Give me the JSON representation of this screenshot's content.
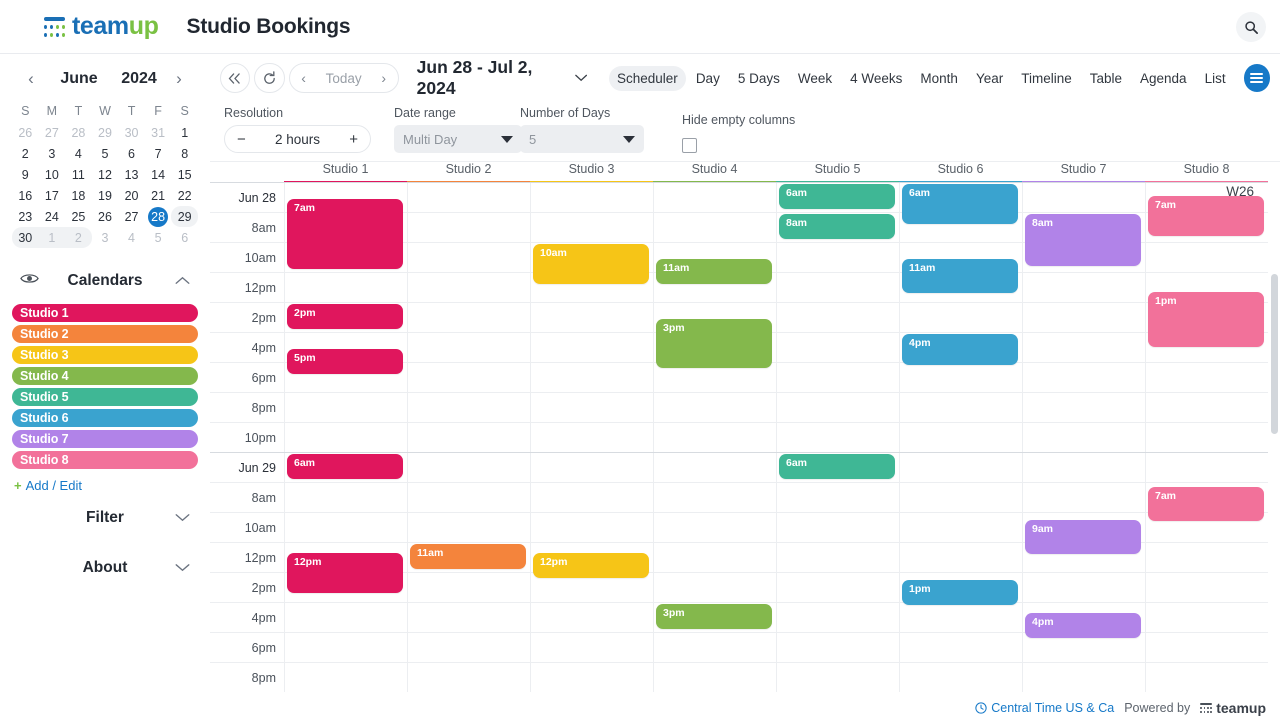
{
  "header": {
    "logo_text_1": "team",
    "logo_text_2": "up",
    "title": "Studio Bookings",
    "search_icon": "search-icon"
  },
  "sidebar": {
    "mini_calendar": {
      "prev_label": "‹",
      "next_label": "›",
      "month": "June",
      "year": "2024",
      "weekday_headers": [
        "S",
        "M",
        "T",
        "W",
        "T",
        "F",
        "S"
      ],
      "weeks": [
        [
          {
            "d": "26",
            "muted": true
          },
          {
            "d": "27",
            "muted": true
          },
          {
            "d": "28",
            "muted": true
          },
          {
            "d": "29",
            "muted": true
          },
          {
            "d": "30",
            "muted": true
          },
          {
            "d": "31",
            "muted": true
          },
          {
            "d": "1",
            "muted": false
          }
        ],
        [
          {
            "d": "2"
          },
          {
            "d": "3"
          },
          {
            "d": "4"
          },
          {
            "d": "5"
          },
          {
            "d": "6"
          },
          {
            "d": "7"
          },
          {
            "d": "8"
          }
        ],
        [
          {
            "d": "9"
          },
          {
            "d": "10"
          },
          {
            "d": "11"
          },
          {
            "d": "12"
          },
          {
            "d": "13"
          },
          {
            "d": "14"
          },
          {
            "d": "15"
          }
        ],
        [
          {
            "d": "16"
          },
          {
            "d": "17"
          },
          {
            "d": "18"
          },
          {
            "d": "19"
          },
          {
            "d": "20"
          },
          {
            "d": "21"
          },
          {
            "d": "22"
          }
        ],
        [
          {
            "d": "23"
          },
          {
            "d": "24"
          },
          {
            "d": "25"
          },
          {
            "d": "26"
          },
          {
            "d": "27"
          },
          {
            "d": "28",
            "selected": true
          },
          {
            "d": "29",
            "inrange": true
          }
        ],
        [
          {
            "d": "30",
            "inrange": true
          },
          {
            "d": "1",
            "muted": true,
            "inrange": true
          },
          {
            "d": "2",
            "muted": true,
            "inrange": true
          },
          {
            "d": "3",
            "muted": true
          },
          {
            "d": "4",
            "muted": true
          },
          {
            "d": "5",
            "muted": true
          },
          {
            "d": "6",
            "muted": true
          }
        ]
      ]
    },
    "calendars_section": {
      "title": "Calendars",
      "eye_icon": "eye-icon",
      "collapse_icon": "chevron-up-icon",
      "items": [
        {
          "label": "Studio 1",
          "color": "#e0165d"
        },
        {
          "label": "Studio 2",
          "color": "#f4843c"
        },
        {
          "label": "Studio 3",
          "color": "#f6c517"
        },
        {
          "label": "Studio 4",
          "color": "#84b84c"
        },
        {
          "label": "Studio 5",
          "color": "#3fb795"
        },
        {
          "label": "Studio 6",
          "color": "#3aa3cf"
        },
        {
          "label": "Studio 7",
          "color": "#b183e8"
        },
        {
          "label": "Studio 8",
          "color": "#f2719a"
        }
      ],
      "add_edit_label": "Add / Edit",
      "add_edit_plus": "+"
    },
    "filter_section": {
      "title": "Filter",
      "chevron": "chevron-down-icon"
    },
    "about_section": {
      "title": "About",
      "chevron": "chevron-down-icon"
    }
  },
  "toolbar": {
    "collapse_icon": "double-chevron-left-icon",
    "refresh_icon": "refresh-icon",
    "prev_label": "‹",
    "today_label": "Today",
    "next_label": "›",
    "date_range": "Jun 28 - Jul 2, 2024",
    "date_range_caret": "⌄",
    "views": [
      {
        "label": "Scheduler",
        "active": true
      },
      {
        "label": "Day",
        "active": false
      },
      {
        "label": "5 Days",
        "active": false
      },
      {
        "label": "Week",
        "active": false
      },
      {
        "label": "4 Weeks",
        "active": false
      },
      {
        "label": "Month",
        "active": false
      },
      {
        "label": "Year",
        "active": false
      },
      {
        "label": "Timeline",
        "active": false
      },
      {
        "label": "Table",
        "active": false
      },
      {
        "label": "Agenda",
        "active": false
      },
      {
        "label": "List",
        "active": false
      }
    ],
    "menu_icon": "hamburger-menu-icon"
  },
  "options": {
    "resolution_label": "Resolution",
    "resolution_minus": "−",
    "resolution_value": "2 hours",
    "resolution_plus": "+",
    "date_range_label": "Date range",
    "date_range_value": "Multi Day",
    "number_of_days_label": "Number of Days",
    "number_of_days_value": "5",
    "hide_empty_label": "Hide empty columns",
    "hide_empty_checked": false
  },
  "scheduler": {
    "week_badge": "W26",
    "columns": [
      {
        "label": "Studio 1",
        "color": "#e0165d"
      },
      {
        "label": "Studio 2",
        "color": "#f4843c"
      },
      {
        "label": "Studio 3",
        "color": "#f6c517"
      },
      {
        "label": "Studio 4",
        "color": "#84b84c"
      },
      {
        "label": "Studio 5",
        "color": "#3fb795"
      },
      {
        "label": "Studio 6",
        "color": "#3aa3cf"
      },
      {
        "label": "Studio 7",
        "color": "#b183e8"
      },
      {
        "label": "Studio 8",
        "color": "#f2719a"
      }
    ],
    "rows": [
      {
        "label": "Jun 28",
        "day_start": true
      },
      {
        "label": "8am"
      },
      {
        "label": "10am"
      },
      {
        "label": "12pm"
      },
      {
        "label": "2pm"
      },
      {
        "label": "4pm"
      },
      {
        "label": "6pm"
      },
      {
        "label": "8pm"
      },
      {
        "label": "10pm"
      },
      {
        "label": "Jun 29",
        "day_start": true
      },
      {
        "label": "8am"
      },
      {
        "label": "10am"
      },
      {
        "label": "12pm"
      },
      {
        "label": "2pm"
      },
      {
        "label": "4pm"
      },
      {
        "label": "6pm"
      },
      {
        "label": "8pm"
      }
    ],
    "events": [
      {
        "time": "7am",
        "col": 0,
        "row": 0,
        "rows": 2.5,
        "offset": 0.5,
        "color": "#e0165d"
      },
      {
        "time": "2pm",
        "col": 0,
        "row": 4,
        "rows": 1,
        "offset": 0.0,
        "color": "#e0165d"
      },
      {
        "time": "5pm",
        "col": 0,
        "row": 5,
        "rows": 1,
        "offset": 0.5,
        "color": "#e0165d"
      },
      {
        "time": "10am",
        "col": 2,
        "row": 2,
        "rows": 1.5,
        "offset": 0.0,
        "color": "#f6c517"
      },
      {
        "time": "11am",
        "col": 3,
        "row": 2,
        "rows": 1,
        "offset": 0.5,
        "color": "#84b84c"
      },
      {
        "time": "3pm",
        "col": 3,
        "row": 4,
        "rows": 1.8,
        "offset": 0.5,
        "color": "#84b84c"
      },
      {
        "time": "6am",
        "col": 4,
        "row": 0,
        "rows": 1,
        "offset": 0.0,
        "color": "#3fb795"
      },
      {
        "time": "8am",
        "col": 4,
        "row": 1,
        "rows": 1,
        "offset": 0.0,
        "color": "#3fb795"
      },
      {
        "time": "6am",
        "col": 5,
        "row": 0,
        "rows": 1.5,
        "offset": 0.0,
        "color": "#3aa3cf"
      },
      {
        "time": "11am",
        "col": 5,
        "row": 2,
        "rows": 1.3,
        "offset": 0.5,
        "color": "#3aa3cf"
      },
      {
        "time": "4pm",
        "col": 5,
        "row": 5,
        "rows": 1.2,
        "offset": 0.0,
        "color": "#3aa3cf"
      },
      {
        "time": "8am",
        "col": 6,
        "row": 1,
        "rows": 1.9,
        "offset": 0.0,
        "color": "#b183e8"
      },
      {
        "time": "7am",
        "col": 7,
        "row": 0,
        "rows": 1.5,
        "offset": 0.4,
        "color": "#f2719a"
      },
      {
        "time": "1pm",
        "col": 7,
        "row": 3,
        "rows": 2.0,
        "offset": 0.6,
        "color": "#f2719a"
      },
      {
        "time": "6am",
        "col": 0,
        "row": 9,
        "rows": 1,
        "offset": 0.0,
        "color": "#e0165d"
      },
      {
        "time": "12pm",
        "col": 0,
        "row": 12,
        "rows": 1.5,
        "offset": 0.3,
        "color": "#e0165d"
      },
      {
        "time": "11am",
        "col": 1,
        "row": 12,
        "rows": 1,
        "offset": 0.0,
        "color": "#f4843c"
      },
      {
        "time": "12pm",
        "col": 2,
        "row": 12,
        "rows": 1,
        "offset": 0.3,
        "color": "#f6c517"
      },
      {
        "time": "3pm",
        "col": 3,
        "row": 14,
        "rows": 1,
        "offset": 0.0,
        "color": "#84b84c"
      },
      {
        "time": "6am",
        "col": 4,
        "row": 9,
        "rows": 1,
        "offset": 0.0,
        "color": "#3fb795"
      },
      {
        "time": "1pm",
        "col": 5,
        "row": 13,
        "rows": 1,
        "offset": 0.2,
        "color": "#3aa3cf"
      },
      {
        "time": "9am",
        "col": 6,
        "row": 11,
        "rows": 1.3,
        "offset": 0.2,
        "color": "#b183e8"
      },
      {
        "time": "4pm",
        "col": 6,
        "row": 14,
        "rows": 1,
        "offset": 0.3,
        "color": "#b183e8"
      },
      {
        "time": "7am",
        "col": 7,
        "row": 10,
        "rows": 1.3,
        "offset": 0.1,
        "color": "#f2719a"
      }
    ]
  },
  "footer": {
    "timezone_icon": "clock-icon",
    "timezone": "Central Time US & Ca",
    "powered_by": "Powered by",
    "brand": "teamup"
  }
}
